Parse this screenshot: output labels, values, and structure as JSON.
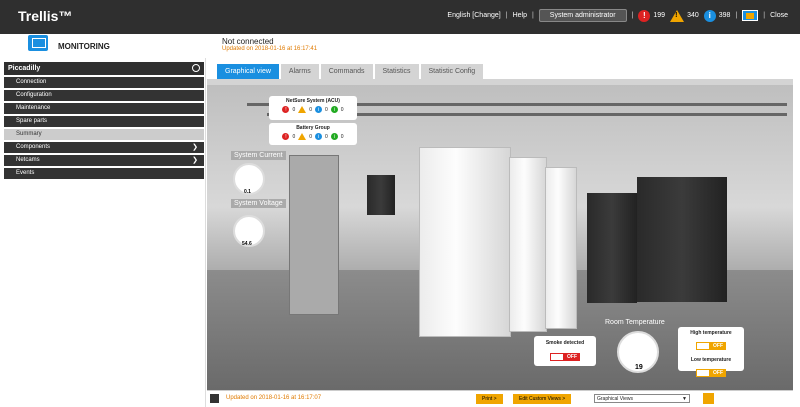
{
  "app": {
    "title": "Trellis™"
  },
  "topbar": {
    "language": "English [Change]",
    "help": "Help",
    "user": "System administrator",
    "alarm_critical": "199",
    "alarm_warning": "340",
    "alarm_info": "398",
    "close": "Close"
  },
  "module": {
    "title": "MONITORING"
  },
  "status": {
    "connection": "Not connected",
    "updated": "Updated on 2018-01-16 at 16:17:41"
  },
  "sidebar": {
    "site": "Piccadilly",
    "items": [
      {
        "label": "Connection",
        "has_arrow": false
      },
      {
        "label": "Configuration",
        "has_arrow": false
      },
      {
        "label": "Maintenance",
        "has_arrow": false
      },
      {
        "label": "Spare parts",
        "has_arrow": false
      },
      {
        "label": "Summary",
        "has_arrow": false,
        "active": true
      },
      {
        "label": "Components",
        "has_arrow": true
      },
      {
        "label": "Netcams",
        "has_arrow": true
      },
      {
        "label": "Events",
        "has_arrow": false
      }
    ]
  },
  "tabs": [
    {
      "label": "Graphical view",
      "active": true
    },
    {
      "label": "Alarms"
    },
    {
      "label": "Commands"
    },
    {
      "label": "Statistics"
    },
    {
      "label": "Statistic Config"
    }
  ],
  "scene": {
    "netsure": {
      "title": "NetSure System (ACU)",
      "critical": "0",
      "warning": "0",
      "info": "0",
      "ok": "0"
    },
    "battery": {
      "title": "Battery Group",
      "critical": "0",
      "warning": "0",
      "info": "0",
      "ok": "0"
    },
    "current": {
      "label": "System Current",
      "value": "0.1"
    },
    "voltage": {
      "label": "System Voltage",
      "value": "54.6"
    },
    "room_temp": {
      "label": "Room Temperature",
      "value": "19"
    },
    "smoke": {
      "label": "Smoke detected",
      "state": "OFF"
    },
    "high_temp": {
      "label": "High temperature",
      "state": "OFF"
    },
    "low_temp": {
      "label": "Low temperature",
      "state": "OFF"
    }
  },
  "bottombar": {
    "updated": "Updated on 2018-01-16 at 16:17:07",
    "print": "Print >",
    "edit_views": "Edit Custom Views >",
    "view_select": "Graphical Views"
  }
}
